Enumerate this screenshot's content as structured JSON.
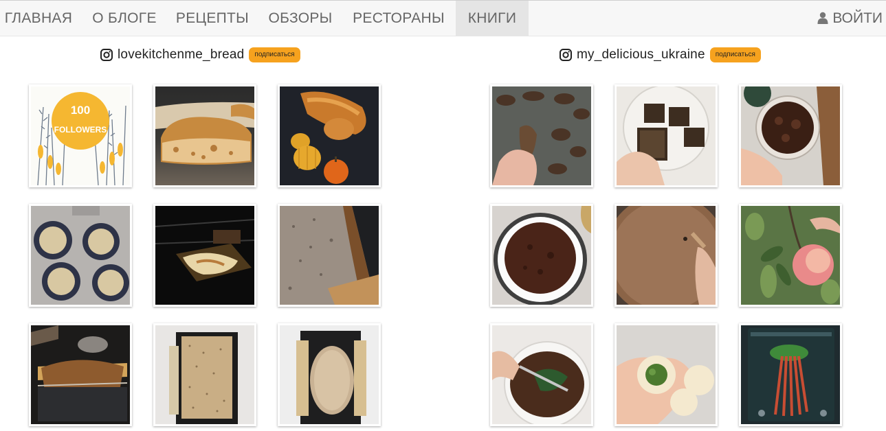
{
  "nav": {
    "items": [
      "ГЛАВНАЯ",
      "О БЛОГЕ",
      "РЕЦЕПТЫ",
      "ОБЗОРЫ",
      "РЕСТОРАНЫ",
      "КНИГИ"
    ],
    "active": "КНИГИ",
    "login_label": "ВОЙТИ",
    "login_icon": "user-icon"
  },
  "feeds": [
    {
      "account": "lovekitchenme_bread",
      "subscribe_label": "подписаться",
      "photos": [
        {
          "subject": "100 followers wheat badge",
          "badge_line1": "100",
          "badge_line2": "FOLLOWERS"
        },
        {
          "subject": "ciabatta bread loaf"
        },
        {
          "subject": "bread with pumpkins"
        },
        {
          "subject": "dough balls in pans"
        },
        {
          "subject": "bread baking in oven"
        },
        {
          "subject": "rye bread slice"
        },
        {
          "subject": "rye loaf in oven"
        },
        {
          "subject": "seeded bread in tin"
        },
        {
          "subject": "dough proofing in tin"
        }
      ]
    },
    {
      "account": "my_delicious_ukraine",
      "subscribe_label": "подписаться",
      "photos": [
        {
          "subject": "dried pear slices"
        },
        {
          "subject": "dark sugar cubes"
        },
        {
          "subject": "jar of jam"
        },
        {
          "subject": "chocolate cake in paper"
        },
        {
          "subject": "mixing batter"
        },
        {
          "subject": "apple on branch"
        },
        {
          "subject": "dumplings with greens on plate"
        },
        {
          "subject": "dumpling with spinach filling"
        },
        {
          "subject": "rhubarb stalks on tablet"
        }
      ]
    }
  ],
  "colors": {
    "accent": "#f6a21e",
    "nav_bg": "#f7f7f7",
    "nav_active": "#e5e5e5",
    "badge": "#f5b731"
  }
}
